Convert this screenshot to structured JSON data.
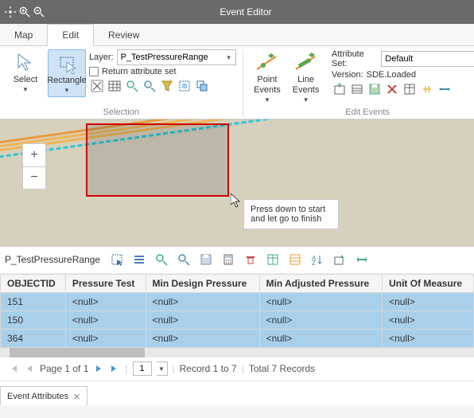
{
  "title": "Event Editor",
  "tabs": {
    "map": "Map",
    "edit": "Edit",
    "review": "Review"
  },
  "ribbon": {
    "select": "Select",
    "rectangle": "Rectangle",
    "layer_label": "Layer:",
    "layer_value": "P_TestPressureRange",
    "return_attr": "Return attribute set",
    "selection_group": "Selection",
    "point_events": "Point\nEvents",
    "line_events": "Line\nEvents",
    "edit_events_group": "Edit Events",
    "attr_set_label": "Attribute Set:",
    "attr_set_value": "Default",
    "version_label": "Version:",
    "version_value": "SDE.Loaded"
  },
  "map": {
    "tooltip": "Press down to start and let go to finish"
  },
  "panel": {
    "name": "P_TestPressureRange"
  },
  "columns": [
    "OBJECTID",
    "Pressure Test",
    "Min Design Pressure",
    "Min Adjusted Pressure",
    "Unit Of Measure"
  ],
  "rows": [
    {
      "c0": "151",
      "c1": "<null>",
      "c2": "<null>",
      "c3": "<null>",
      "c4": "<null>"
    },
    {
      "c0": "150",
      "c1": "<null>",
      "c2": "<null>",
      "c3": "<null>",
      "c4": "<null>"
    },
    {
      "c0": "364",
      "c1": "<null>",
      "c2": "<null>",
      "c3": "<null>",
      "c4": "<null>"
    }
  ],
  "pager": {
    "page_text": "Page 1 of 1",
    "page_input": "1",
    "records_text": "Record 1 to 7",
    "total_text": "Total 7 Records"
  },
  "bottom_tab": "Event Attributes"
}
